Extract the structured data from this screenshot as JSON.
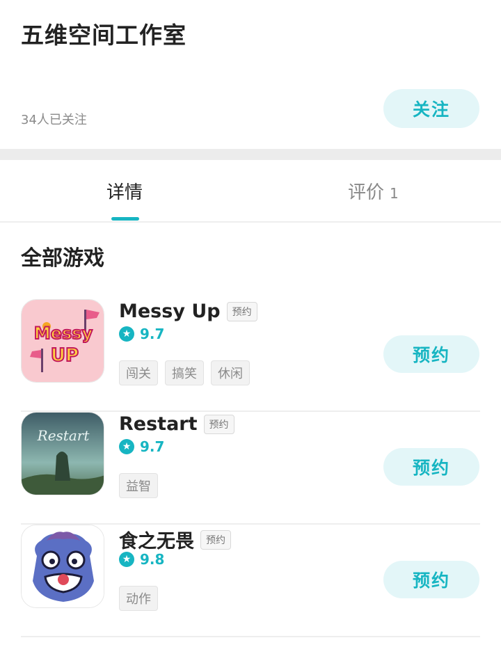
{
  "developer": {
    "name": "五维空间工作室",
    "followers": "34人已关注",
    "follow_label": "关注"
  },
  "tabs": [
    {
      "label": "详情",
      "active": true
    },
    {
      "label": "评价",
      "count": "1",
      "active": false
    }
  ],
  "section_title": "全部游戏",
  "games": [
    {
      "name": "Messy Up",
      "badge": "预约",
      "rating": "9.7",
      "tags": [
        "闯关",
        "搞笑",
        "休闲"
      ],
      "button": "预约",
      "icon": "messy-up-icon",
      "icon_text": [
        "Messy",
        "UP"
      ]
    },
    {
      "name": "Restart",
      "badge": "预约",
      "rating": "9.7",
      "tags": [
        "益智"
      ],
      "button": "预约",
      "icon": "restart-icon",
      "icon_text": "Restart"
    },
    {
      "name": "食之无畏",
      "badge": "预约",
      "rating": "9.8",
      "tags": [
        "动作"
      ],
      "button": "预约",
      "icon": "lion-mask-icon"
    }
  ],
  "colors": {
    "accent": "#17b5c2",
    "button_bg": "#e3f6f8",
    "divider": "#ececec"
  }
}
